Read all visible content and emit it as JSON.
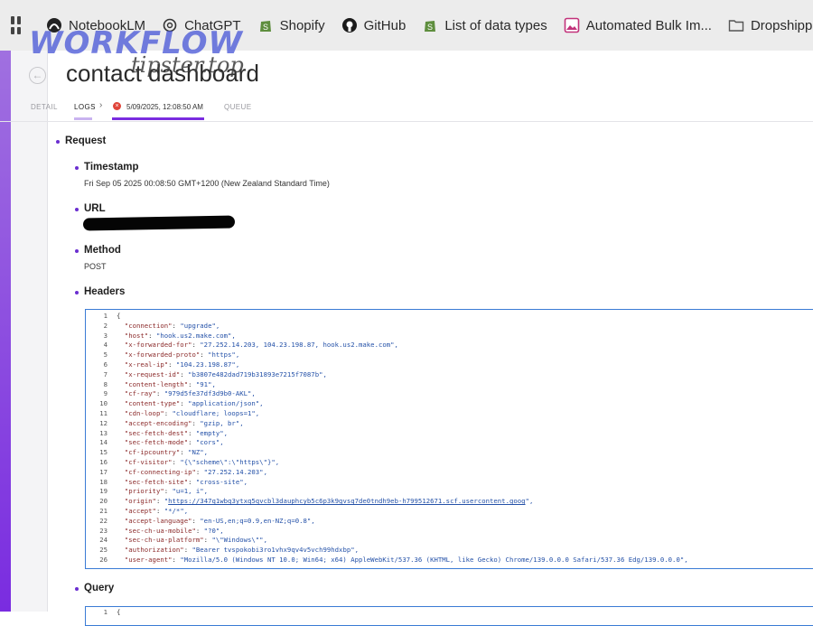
{
  "bookmarks": [
    {
      "label": "NotebookLM",
      "icon": "notebooklm-icon"
    },
    {
      "label": "ChatGPT",
      "icon": "chatgpt-icon"
    },
    {
      "label": "Shopify",
      "icon": "shopify-icon"
    },
    {
      "label": "GitHub",
      "icon": "github-icon"
    },
    {
      "label": "List of data types",
      "icon": "shopify-icon"
    },
    {
      "label": "Automated Bulk Im...",
      "icon": "image-icon"
    },
    {
      "label": "Dropshipping",
      "icon": "folder-icon"
    }
  ],
  "watermark": {
    "line1": "WORKFLOW",
    "line2": "tipster.top"
  },
  "header": {
    "title": "contact dashboard"
  },
  "tabs": {
    "detail": "DETAIL",
    "logs": "LOGS",
    "separator": "›",
    "log_time": "5/09/2025, 12:08:50 AM",
    "queue": "QUEUE"
  },
  "request": {
    "heading": "Request",
    "timestamp_label": "Timestamp",
    "timestamp_value": "Fri Sep 05 2025 00:08:50 GMT+1200 (New Zealand Standard Time)",
    "url_label": "URL",
    "method_label": "Method",
    "method_value": "POST",
    "headers_label": "Headers",
    "query_label": "Query"
  },
  "headers_json_lines": [
    {
      "n": "1",
      "text": "{"
    },
    {
      "n": "2",
      "key": "\"connection\"",
      "val": "\"upgrade\","
    },
    {
      "n": "3",
      "key": "\"host\"",
      "val": "\"hook.us2.make.com\","
    },
    {
      "n": "4",
      "key": "\"x-forwarded-for\"",
      "val": "\"27.252.14.203, 104.23.198.87, hook.us2.make.com\","
    },
    {
      "n": "5",
      "key": "\"x-forwarded-proto\"",
      "val": "\"https\","
    },
    {
      "n": "6",
      "key": "\"x-real-ip\"",
      "val": "\"104.23.198.87\","
    },
    {
      "n": "7",
      "key": "\"x-request-id\"",
      "val": "\"b3807e482dad719b31893e7215f7087b\","
    },
    {
      "n": "8",
      "key": "\"content-length\"",
      "val": "\"91\","
    },
    {
      "n": "9",
      "key": "\"cf-ray\"",
      "val": "\"979d5fe37df3d9b0-AKL\","
    },
    {
      "n": "10",
      "key": "\"content-type\"",
      "val": "\"application/json\","
    },
    {
      "n": "11",
      "key": "\"cdn-loop\"",
      "val": "\"cloudflare; loops=1\","
    },
    {
      "n": "12",
      "key": "\"accept-encoding\"",
      "val": "\"gzip, br\","
    },
    {
      "n": "13",
      "key": "\"sec-fetch-dest\"",
      "val": "\"empty\","
    },
    {
      "n": "14",
      "key": "\"sec-fetch-mode\"",
      "val": "\"cors\","
    },
    {
      "n": "15",
      "key": "\"cf-ipcountry\"",
      "val": "\"NZ\","
    },
    {
      "n": "16",
      "key": "\"cf-visitor\"",
      "val": "\"{\\\"scheme\\\":\\\"https\\\"}\","
    },
    {
      "n": "17",
      "key": "\"cf-connecting-ip\"",
      "val": "\"27.252.14.203\","
    },
    {
      "n": "18",
      "key": "\"sec-fetch-site\"",
      "val": "\"cross-site\","
    },
    {
      "n": "19",
      "key": "\"priority\"",
      "val": "\"u=1, i\","
    },
    {
      "n": "20",
      "key": "\"origin\"",
      "val": "\"",
      "url": "https://347q1wbq3ytxq5qvcbl3dauphcyb5c6p3k9gvsq7de0tndh9eb-h799512671.scf.usercontent.goog",
      "tail": "\","
    },
    {
      "n": "21",
      "key": "\"accept\"",
      "val": "\"*/*\","
    },
    {
      "n": "22",
      "key": "\"accept-language\"",
      "val": "\"en-US,en;q=0.9,en-NZ;q=0.8\","
    },
    {
      "n": "23",
      "key": "\"sec-ch-ua-mobile\"",
      "val": "\"?0\","
    },
    {
      "n": "24",
      "key": "\"sec-ch-ua-platform\"",
      "val": "\"\\\"Windows\\\"\","
    },
    {
      "n": "25",
      "key": "\"authorization\"",
      "val": "\"Bearer tvspokobi3ro1vhx9qv4v5vch99hdxbp\","
    },
    {
      "n": "26",
      "key": "\"user-agent\"",
      "val": "\"Mozilla/5.0 (Windows NT 10.0; Win64; x64) AppleWebKit/537.36 (KHTML, like Gecko) Chrome/139.0.0.0 Safari/537.36 Edg/139.0.0.0\","
    }
  ],
  "query_json_lines": [
    {
      "n": "1",
      "text": "{"
    }
  ],
  "colors": {
    "accent": "#7a2ce0",
    "error": "#e0453a",
    "code_border": "#3a7bd5"
  }
}
